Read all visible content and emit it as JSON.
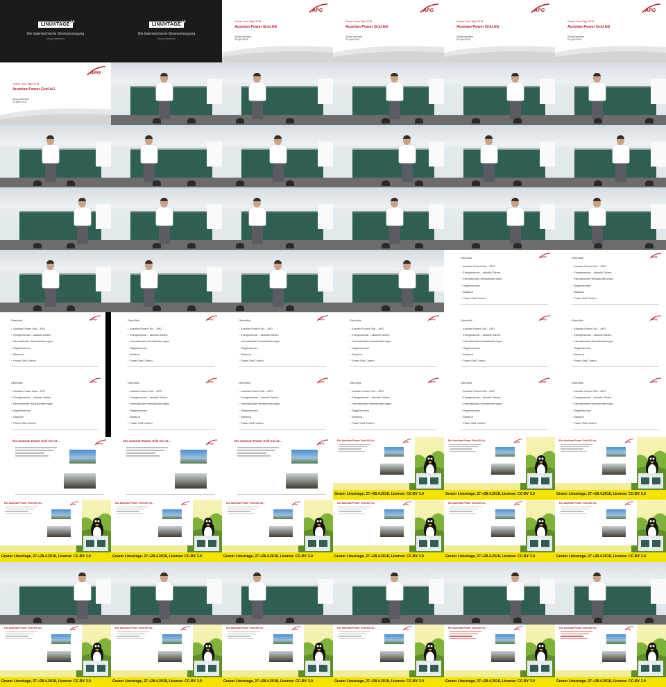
{
  "title_slide": {
    "logo": "LINUXTAGE",
    "logo_suffix": "18",
    "subtitle": "Die österreichische Stromversorgung",
    "author": "Georg Schlehner"
  },
  "apg_slide": {
    "event": "Grazer Linux Tage 2018",
    "name": "Austrian Power Grid AG",
    "author": "Georg Schlehner",
    "date": "28. April 2018"
  },
  "agenda_slide": {
    "heading": "Überblick",
    "items": [
      "Austrian Power Grid – APG",
      "Energiewende – aktuelle Zahlen",
      "Internationale Herausforderungen",
      "Regelreserven",
      "Blackout",
      "Power Grid Control"
    ]
  },
  "ist_slide": {
    "heading": "Die Austrian Power Grid AG ist..."
  },
  "overlay": {
    "banner": "Grazer Linuxtage, 27.+28.4.2018, License: CC-BY 3.0"
  },
  "colors": {
    "apg_red": "#b01e23",
    "banner_yellow": "#f4e300",
    "board_green": "#2f5e52"
  },
  "tiles": [
    "title",
    "title",
    "apg",
    "apg",
    "apg",
    "apg",
    "apg",
    "cam",
    "cam",
    "cam",
    "cam",
    "cam",
    "cam",
    "cam",
    "cam",
    "cam",
    "cam",
    "cam",
    "cam",
    "cam",
    "cam",
    "cam",
    "cam",
    "cam",
    "cam",
    "cam",
    "cam",
    "cam",
    "agenda",
    "agenda",
    "agenda",
    "agenda",
    "agenda",
    "agenda",
    "agenda",
    "agenda",
    "agenda",
    "agenda",
    "agenda",
    "agenda",
    "agenda",
    "agenda",
    "ist",
    "ist",
    "ist",
    "comp",
    "comp",
    "comp",
    "comp",
    "comp",
    "comp",
    "comp",
    "comp",
    "comp",
    "cam",
    "cam",
    "cam",
    "cam",
    "cam",
    "cam",
    "comp",
    "comp",
    "comp",
    "comp",
    "comp-red",
    "comp-red"
  ]
}
